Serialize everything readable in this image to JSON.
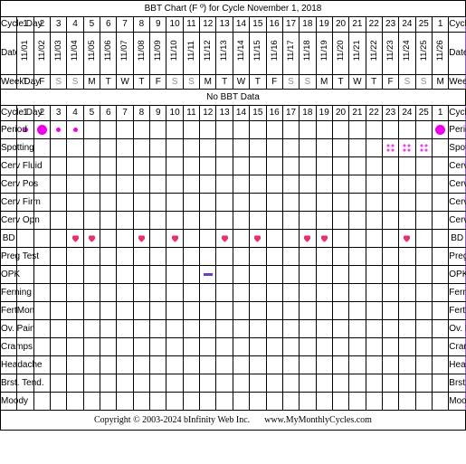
{
  "title": "BBT Chart (F º) for Cycle November 1, 2018",
  "footer": {
    "copyright": "Copyright © 2003-2024 bInfinity Web Inc.",
    "website": "www.MyMonthlyCycles.com"
  },
  "headers": {
    "cycle_day_label": "Cycle Day",
    "date_label": "Date",
    "weekday_label": "WeekDay",
    "no_bbt_data": "No BBT Data"
  },
  "columns": {
    "cycle_days": [
      "1",
      "2",
      "3",
      "4",
      "5",
      "6",
      "7",
      "8",
      "9",
      "10",
      "11",
      "12",
      "13",
      "14",
      "15",
      "16",
      "17",
      "18",
      "19",
      "20",
      "21",
      "22",
      "23",
      "24",
      "25",
      "1"
    ],
    "dates": [
      "11/01",
      "11/02",
      "11/03",
      "11/04",
      "11/05",
      "11/06",
      "11/07",
      "11/08",
      "11/09",
      "11/10",
      "11/11",
      "11/12",
      "11/13",
      "11/14",
      "11/15",
      "11/16",
      "11/17",
      "11/18",
      "11/19",
      "11/20",
      "11/21",
      "11/22",
      "11/23",
      "11/24",
      "11/25",
      "11/26"
    ],
    "weekdays": [
      "T",
      "F",
      "S",
      "S",
      "M",
      "T",
      "W",
      "T",
      "F",
      "S",
      "S",
      "M",
      "T",
      "W",
      "T",
      "F",
      "S",
      "S",
      "M",
      "T",
      "W",
      "T",
      "F",
      "S",
      "S",
      "M"
    ],
    "weekend_flags": [
      false,
      false,
      true,
      true,
      false,
      false,
      false,
      false,
      false,
      true,
      true,
      false,
      false,
      false,
      false,
      false,
      true,
      true,
      false,
      false,
      false,
      false,
      false,
      true,
      true,
      false
    ]
  },
  "rows": [
    {
      "key": "period",
      "label": "Period",
      "label_right": "Period",
      "marks": [
        {
          "col": 1,
          "type": "dot-sm"
        },
        {
          "col": 2,
          "type": "dot-lg"
        },
        {
          "col": 3,
          "type": "dot-sm"
        },
        {
          "col": 4,
          "type": "dot-sm"
        },
        {
          "col": 26,
          "type": "dot-lg"
        }
      ]
    },
    {
      "key": "spotting",
      "label": "Spotting",
      "label_right": "Spotting",
      "marks": [
        {
          "col": 23,
          "type": "spot"
        },
        {
          "col": 24,
          "type": "spot"
        },
        {
          "col": 25,
          "type": "spot"
        }
      ]
    },
    {
      "key": "cerv_fluid",
      "label": "Cerv Fluid",
      "label_right": "Cerv Fluid",
      "marks": []
    },
    {
      "key": "cerv_pos",
      "label": "Cerv Pos",
      "label_right": "Cerv Pos",
      "marks": []
    },
    {
      "key": "cerv_firm",
      "label": "Cerv Firm",
      "label_right": "Cerv Firm",
      "marks": []
    },
    {
      "key": "cerv_opn",
      "label": "Cerv Opn",
      "label_right": "Cerv Opn",
      "marks": []
    },
    {
      "key": "bd",
      "label": "BD",
      "label_right": "BD",
      "marks": [
        {
          "col": 4,
          "type": "heart"
        },
        {
          "col": 5,
          "type": "heart"
        },
        {
          "col": 8,
          "type": "heart"
        },
        {
          "col": 10,
          "type": "heart"
        },
        {
          "col": 13,
          "type": "heart"
        },
        {
          "col": 15,
          "type": "heart"
        },
        {
          "col": 18,
          "type": "heart"
        },
        {
          "col": 19,
          "type": "heart"
        },
        {
          "col": 24,
          "type": "heart"
        }
      ]
    },
    {
      "key": "preg_test",
      "label": "Preg Test",
      "label_right": "Preg Test",
      "marks": []
    },
    {
      "key": "opk",
      "label": "OPK",
      "label_right": "OPK",
      "marks": [
        {
          "col": 12,
          "type": "opk-dash"
        }
      ]
    },
    {
      "key": "ferning",
      "label": "Ferning",
      "label_right": "Ferning",
      "marks": []
    },
    {
      "key": "fertmon",
      "label": "FertMon",
      "label_right": "FertMon",
      "marks": []
    },
    {
      "key": "ov_pain",
      "label": "Ov. Pain",
      "label_right": "Ov. Pain",
      "marks": []
    },
    {
      "key": "cramps",
      "label": "Cramps",
      "label_right": "Cramps",
      "marks": []
    },
    {
      "key": "headache",
      "label": "Headache",
      "label_right": "Headache",
      "marks": []
    },
    {
      "key": "brst_tend",
      "label": "Brst. Tend.",
      "label_right": "Brst. Tend",
      "marks": []
    },
    {
      "key": "moody",
      "label": "Moody",
      "label_right": "Moody",
      "marks": []
    }
  ],
  "colors": {
    "period_dot": "#ee00ee",
    "spotting_dot": "#ee44ee",
    "bd_heart": "#e8326e",
    "opk_dash": "#6b3fc4",
    "border_outer": "#9a5fc4",
    "label_bg": "#fbeffa",
    "cycleday_text": "#9c3500"
  }
}
